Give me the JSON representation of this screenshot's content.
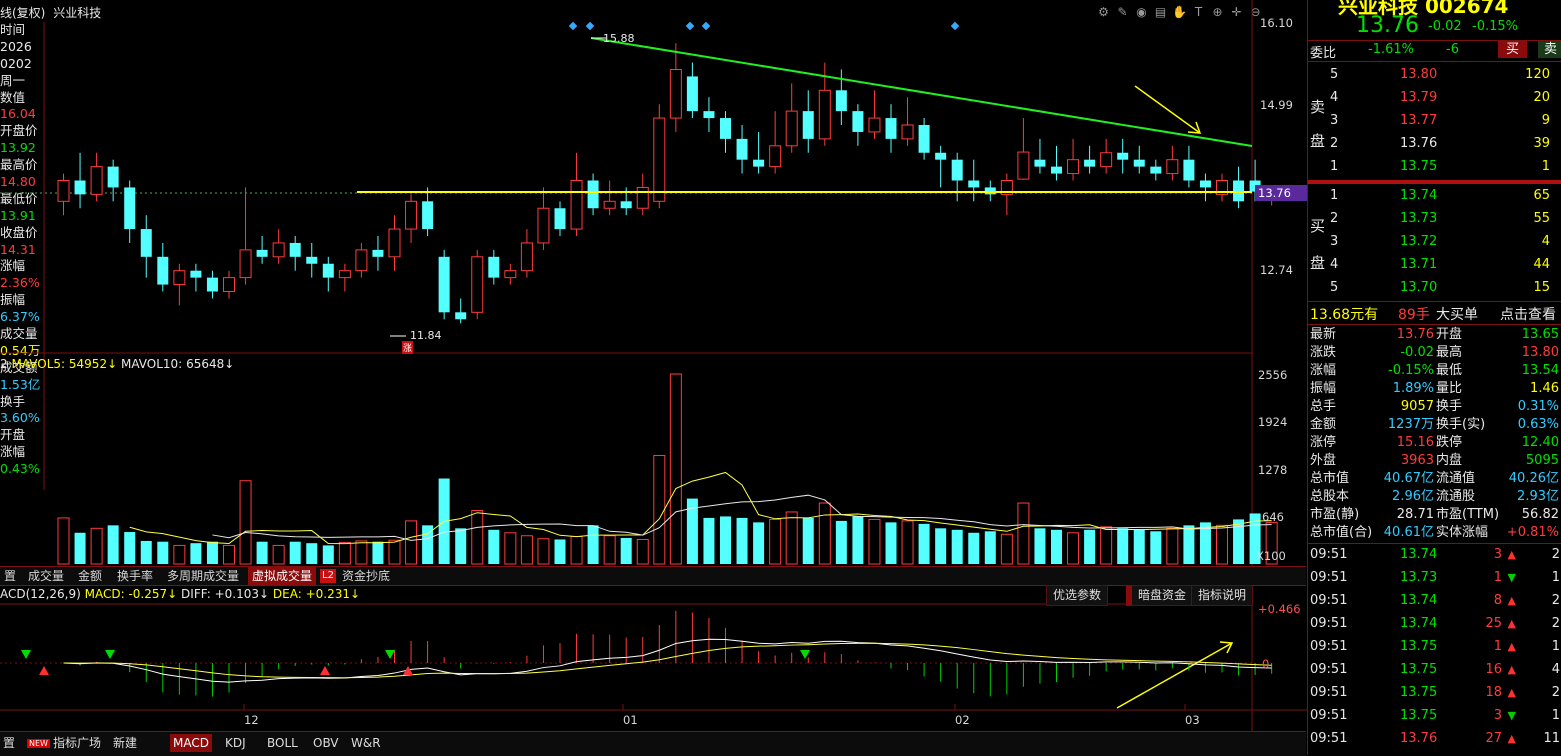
{
  "chart_header": {
    "mode": "线(复权)",
    "name": "兴业科技"
  },
  "left_strip": [
    {
      "t": "时间",
      "c": "white"
    },
    {
      "t": "2026",
      "c": "white"
    },
    {
      "t": "0202",
      "c": "white"
    },
    {
      "t": "周一",
      "c": "white"
    },
    {
      "t": "数值",
      "c": "white"
    },
    {
      "t": "16.04",
      "c": "red"
    },
    {
      "t": "开盘价",
      "c": "white"
    },
    {
      "t": "13.92",
      "c": "green"
    },
    {
      "t": "最高价",
      "c": "white"
    },
    {
      "t": "14.80",
      "c": "red"
    },
    {
      "t": "最低价",
      "c": "white"
    },
    {
      "t": "13.91",
      "c": "green"
    },
    {
      "t": "收盘价",
      "c": "white"
    },
    {
      "t": "14.31",
      "c": "red"
    },
    {
      "t": "涨幅",
      "c": "white"
    },
    {
      "t": "2.36%",
      "c": "red"
    },
    {
      "t": "振幅",
      "c": "white"
    },
    {
      "t": "6.37%",
      "c": "cyan"
    },
    {
      "t": "成交量",
      "c": "white"
    },
    {
      "t": "0.54万",
      "c": "yellow"
    },
    {
      "t": "成交额",
      "c": "white"
    },
    {
      "t": "1.53亿",
      "c": "cyan"
    },
    {
      "t": "换手",
      "c": "white"
    },
    {
      "t": "3.60%",
      "c": "cyan"
    },
    {
      "t": "开盘",
      "c": "white"
    },
    {
      "t": "涨幅",
      "c": "white"
    },
    {
      "t": "0.43%",
      "c": "green"
    }
  ],
  "price_axis": [
    "16.10",
    "14.99",
    "12.74"
  ],
  "current_price_tag": "13.76",
  "high_marker": "15.88",
  "low_marker": "11.84",
  "low_badge": "涨",
  "volume_header": {
    "prefix": "2",
    "ma5_label": "MAVOL5:",
    "ma5_value": "54952",
    "ma10_label": "MAVOL10:",
    "ma10_value": "65648"
  },
  "volume_axis": [
    "2556",
    "1924",
    "1278",
    "646",
    "X100"
  ],
  "tabs": [
    {
      "label": "置",
      "active": false
    },
    {
      "label": "成交量",
      "active": false
    },
    {
      "label": "金额",
      "active": false
    },
    {
      "label": "换手率",
      "active": false
    },
    {
      "label": "多周期成交量",
      "active": false
    },
    {
      "label": "虚拟成交量",
      "active": true
    },
    {
      "label": "L2",
      "active": false
    },
    {
      "label": "资金抄底",
      "active": false
    }
  ],
  "macd_header": {
    "name": "ACD(12,26,9)",
    "macd_label": "MACD:",
    "macd_value": "-0.257",
    "diff_label": "DIFF:",
    "diff_value": "+0.103",
    "dea_label": "DEA:",
    "dea_value": "+0.231"
  },
  "macd_buttons": {
    "params": "优选参数",
    "dark": "暗盘资金",
    "explain": "指标说明"
  },
  "macd_axis": [
    "+0.466",
    "0"
  ],
  "time_axis": [
    "12",
    "01",
    "02",
    "03"
  ],
  "bottom_tabs": [
    {
      "label": "置",
      "active": false
    },
    {
      "label": "指标广场",
      "active": false,
      "badge": "NEW"
    },
    {
      "label": "新建",
      "active": false
    },
    {
      "label": "MACD",
      "active": true
    },
    {
      "label": "KDJ",
      "active": false
    },
    {
      "label": "BOLL",
      "active": false
    },
    {
      "label": "OBV",
      "active": false
    },
    {
      "label": "W&R",
      "active": false
    }
  ],
  "quote": {
    "title": "兴业科技 002674",
    "price": "13.76",
    "change": "-0.02",
    "pct": "-0.15%",
    "weibi_label": "委比",
    "weibi": "-1.61%",
    "weicha": "-6",
    "buy_btn": "买",
    "sell_btn": "卖",
    "sell_label": [
      "卖",
      "盘"
    ],
    "buy_label": [
      "买",
      "盘"
    ],
    "asks": [
      {
        "n": "5",
        "p": "13.80",
        "v": "120"
      },
      {
        "n": "4",
        "p": "13.79",
        "v": "20"
      },
      {
        "n": "3",
        "p": "13.77",
        "v": "9"
      },
      {
        "n": "2",
        "p": "13.76",
        "v": "39"
      },
      {
        "n": "1",
        "p": "13.75",
        "v": "1"
      }
    ],
    "bids": [
      {
        "n": "1",
        "p": "13.74",
        "v": "65"
      },
      {
        "n": "2",
        "p": "13.73",
        "v": "55"
      },
      {
        "n": "3",
        "p": "13.72",
        "v": "4"
      },
      {
        "n": "4",
        "p": "13.71",
        "v": "44"
      },
      {
        "n": "5",
        "p": "13.70",
        "v": "15"
      }
    ],
    "big_order": {
      "price": "13.68元有",
      "qty": "89手",
      "label": "大买单",
      "link": "点击查看"
    },
    "stats": [
      [
        "最新",
        "13.76",
        "red",
        "开盘",
        "13.65",
        "green"
      ],
      [
        "涨跌",
        "-0.02",
        "green",
        "最高",
        "13.80",
        "red"
      ],
      [
        "涨幅",
        "-0.15%",
        "green",
        "最低",
        "13.54",
        "green"
      ],
      [
        "振幅",
        "1.89%",
        "cyan",
        "量比",
        "1.46",
        "yellow"
      ],
      [
        "总手",
        "9057",
        "yellow",
        "换手",
        "0.31%",
        "cyan"
      ],
      [
        "金额",
        "1237万",
        "cyan",
        "换手(实)",
        "0.63%",
        "cyan"
      ],
      [
        "涨停",
        "15.16",
        "red",
        "跌停",
        "12.40",
        "green"
      ],
      [
        "外盘",
        "3963",
        "red",
        "内盘",
        "5095",
        "green"
      ],
      [
        "总市值",
        "40.67亿",
        "cyan",
        "流通值",
        "40.26亿",
        "cyan"
      ],
      [
        "总股本",
        "2.96亿",
        "cyan",
        "流通股",
        "2.93亿",
        "cyan"
      ],
      [
        "市盈(静)",
        "28.71",
        "white",
        "市盈(TTM)",
        "56.82",
        "white"
      ],
      [
        "总市值(合)",
        "40.61亿",
        "cyan",
        "实体涨幅",
        "+0.81%",
        "red"
      ]
    ],
    "ticks": [
      {
        "t": "09:51",
        "p": "13.74",
        "pc": "green",
        "v": "3",
        "d": "up",
        "c": "2"
      },
      {
        "t": "09:51",
        "p": "13.73",
        "pc": "green",
        "v": "1",
        "d": "down",
        "c": "1"
      },
      {
        "t": "09:51",
        "p": "13.74",
        "pc": "green",
        "v": "8",
        "d": "up",
        "c": "2"
      },
      {
        "t": "09:51",
        "p": "13.74",
        "pc": "green",
        "v": "25",
        "d": "up",
        "c": "2"
      },
      {
        "t": "09:51",
        "p": "13.75",
        "pc": "green",
        "v": "1",
        "d": "up",
        "c": "1"
      },
      {
        "t": "09:51",
        "p": "13.75",
        "pc": "green",
        "v": "16",
        "d": "up",
        "c": "4"
      },
      {
        "t": "09:51",
        "p": "13.75",
        "pc": "green",
        "v": "18",
        "d": "up",
        "c": "2"
      },
      {
        "t": "09:51",
        "p": "13.75",
        "pc": "green",
        "v": "3",
        "d": "down",
        "c": "1"
      },
      {
        "t": "09:51",
        "p": "13.76",
        "pc": "red",
        "v": "27",
        "d": "up",
        "c": "11"
      }
    ]
  },
  "chart_data": {
    "type": "candlestick",
    "price_range": [
      11.5,
      16.3
    ],
    "candles": [
      [
        13.6,
        13.9,
        13.4,
        14.0
      ],
      [
        13.9,
        13.7,
        13.5,
        14.3
      ],
      [
        13.7,
        14.1,
        13.6,
        14.3
      ],
      [
        14.1,
        13.8,
        13.6,
        14.2
      ],
      [
        13.8,
        13.2,
        13.0,
        13.9
      ],
      [
        13.2,
        12.8,
        12.5,
        13.4
      ],
      [
        12.8,
        12.4,
        12.3,
        13.0
      ],
      [
        12.4,
        12.6,
        12.1,
        12.7
      ],
      [
        12.6,
        12.5,
        12.3,
        12.7
      ],
      [
        12.5,
        12.3,
        12.2,
        12.6
      ],
      [
        12.3,
        12.5,
        12.2,
        12.6
      ],
      [
        12.5,
        12.9,
        12.4,
        13.8
      ],
      [
        12.9,
        12.8,
        12.7,
        13.1
      ],
      [
        12.8,
        13.0,
        12.7,
        13.2
      ],
      [
        13.0,
        12.8,
        12.6,
        13.1
      ],
      [
        12.8,
        12.7,
        12.5,
        13.0
      ],
      [
        12.7,
        12.5,
        12.3,
        12.8
      ],
      [
        12.5,
        12.6,
        12.3,
        12.7
      ],
      [
        12.6,
        12.9,
        12.5,
        13.0
      ],
      [
        12.9,
        12.8,
        12.6,
        13.1
      ],
      [
        12.8,
        13.2,
        12.6,
        13.4
      ],
      [
        13.2,
        13.6,
        13.0,
        13.7
      ],
      [
        13.6,
        13.2,
        13.1,
        13.8
      ],
      [
        12.8,
        12.0,
        11.9,
        12.9
      ],
      [
        12.0,
        11.9,
        11.84,
        12.2
      ],
      [
        12.0,
        12.8,
        11.9,
        12.9
      ],
      [
        12.8,
        12.5,
        12.4,
        12.9
      ],
      [
        12.5,
        12.6,
        12.4,
        12.7
      ],
      [
        12.6,
        13.0,
        12.5,
        13.2
      ],
      [
        13.0,
        13.5,
        12.9,
        13.8
      ],
      [
        13.5,
        13.2,
        13.1,
        13.6
      ],
      [
        13.2,
        13.9,
        13.1,
        14.3
      ],
      [
        13.9,
        13.5,
        13.4,
        14.0
      ],
      [
        13.5,
        13.6,
        13.4,
        13.9
      ],
      [
        13.6,
        13.5,
        13.4,
        13.8
      ],
      [
        13.5,
        13.8,
        13.4,
        14.0
      ],
      [
        13.6,
        14.8,
        13.5,
        15.0
      ],
      [
        14.8,
        15.5,
        14.6,
        15.88
      ],
      [
        15.4,
        14.9,
        14.8,
        15.6
      ],
      [
        14.9,
        14.8,
        14.6,
        15.1
      ],
      [
        14.8,
        14.5,
        14.3,
        14.9
      ],
      [
        14.5,
        14.2,
        14.0,
        14.7
      ],
      [
        14.2,
        14.1,
        14.0,
        14.6
      ],
      [
        14.1,
        14.4,
        14.0,
        14.9
      ],
      [
        14.4,
        14.9,
        14.3,
        15.3
      ],
      [
        14.9,
        14.5,
        14.3,
        15.2
      ],
      [
        14.5,
        15.2,
        14.4,
        15.6
      ],
      [
        15.2,
        14.9,
        14.7,
        15.5
      ],
      [
        14.9,
        14.6,
        14.4,
        15.0
      ],
      [
        14.6,
        14.8,
        14.5,
        15.2
      ],
      [
        14.8,
        14.5,
        14.3,
        15.0
      ],
      [
        14.5,
        14.7,
        14.4,
        15.1
      ],
      [
        14.7,
        14.3,
        14.2,
        14.8
      ],
      [
        14.3,
        14.2,
        13.8,
        14.4
      ],
      [
        14.2,
        13.9,
        13.6,
        14.3
      ],
      [
        13.9,
        13.8,
        13.6,
        14.2
      ],
      [
        13.8,
        13.7,
        13.6,
        13.9
      ],
      [
        13.7,
        13.9,
        13.4,
        14.0
      ],
      [
        13.92,
        14.31,
        13.91,
        14.8
      ],
      [
        14.2,
        14.1,
        14.0,
        14.5
      ],
      [
        14.1,
        14.0,
        13.9,
        14.4
      ],
      [
        14.0,
        14.2,
        13.9,
        14.5
      ],
      [
        14.2,
        14.1,
        14.0,
        14.4
      ],
      [
        14.1,
        14.3,
        14.0,
        14.5
      ],
      [
        14.3,
        14.2,
        14.0,
        14.5
      ],
      [
        14.2,
        14.1,
        14.0,
        14.4
      ],
      [
        14.1,
        14.0,
        13.9,
        14.2
      ],
      [
        14.0,
        14.2,
        13.9,
        14.4
      ],
      [
        14.2,
        13.9,
        13.8,
        14.4
      ],
      [
        13.9,
        13.8,
        13.6,
        14.0
      ],
      [
        13.7,
        13.9,
        13.6,
        14.0
      ],
      [
        13.9,
        13.6,
        13.5,
        14.1
      ],
      [
        13.9,
        13.74,
        13.6,
        14.2
      ],
      [
        13.65,
        13.76,
        13.54,
        13.8
      ]
    ],
    "volume": [
      620,
      420,
      480,
      520,
      430,
      310,
      300,
      250,
      280,
      300,
      250,
      1120,
      300,
      250,
      300,
      280,
      250,
      290,
      310,
      300,
      320,
      580,
      520,
      1150,
      480,
      720,
      460,
      420,
      380,
      340,
      330,
      370,
      520,
      380,
      350,
      330,
      1460,
      2556,
      880,
      620,
      640,
      620,
      560,
      600,
      700,
      620,
      820,
      580,
      640,
      600,
      560,
      580,
      540,
      480,
      460,
      420,
      440,
      400,
      820,
      480,
      460,
      420,
      460,
      500,
      480,
      460,
      440,
      480,
      520,
      560,
      520,
      600,
      680,
      560
    ],
    "volume_ma": []
  }
}
